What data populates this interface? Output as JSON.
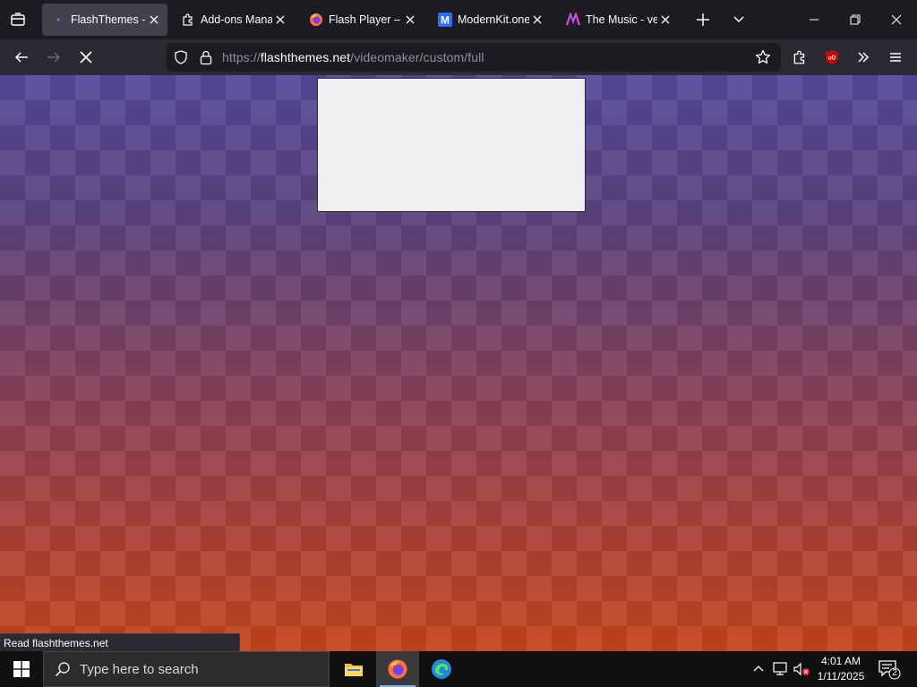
{
  "browser": {
    "tabs": [
      {
        "title": "FlashThemes - C",
        "favicon": "loading-dot-icon",
        "active": true
      },
      {
        "title": "Add-ons Manag",
        "favicon": "puzzle-icon",
        "active": false
      },
      {
        "title": "Flash Player – Ge",
        "favicon": "firefox-icon",
        "active": false
      },
      {
        "title": "ModernKit.one",
        "favicon": "modernkit-m-icon",
        "active": false
      },
      {
        "title": "The Music - very",
        "favicon": "music-m-icon",
        "active": false
      }
    ],
    "url": {
      "scheme": "https://",
      "host": "flashthemes.net",
      "path": "/videomaker/custom/full"
    },
    "status_text": "Read flashthemes.net"
  },
  "taskbar": {
    "search_placeholder": "Type here to search",
    "time": "4:01 AM",
    "date": "1/11/2025",
    "notification_count": "2"
  },
  "colors": {
    "chrome_dark": "#1c1b22",
    "navbar": "#2b2a33",
    "ublock_red": "#c50a0a",
    "gradient_top": "#54489a",
    "gradient_bottom": "#c4441c"
  }
}
